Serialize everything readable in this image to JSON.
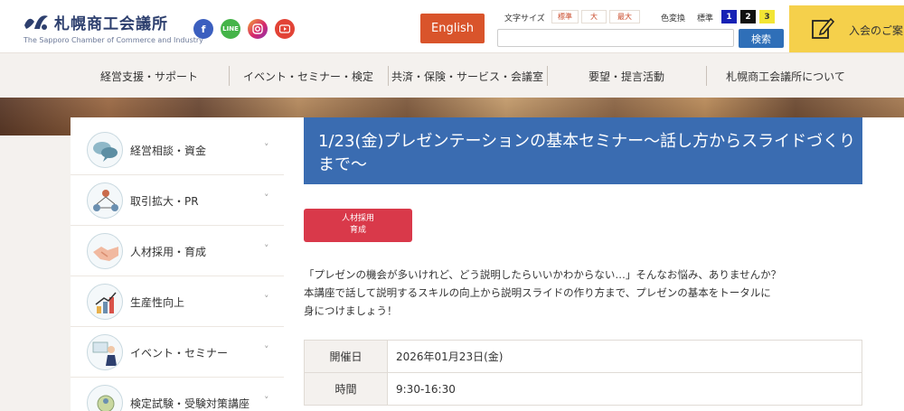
{
  "header": {
    "logo_title": "札幌商工会議所",
    "logo_subtitle": "The Sapporo Chamber of Commerce and Industry",
    "sns": {
      "line_label": "LINE"
    },
    "english_label": "English",
    "font_size": {
      "label": "文字サイズ",
      "options": [
        "標準",
        "大",
        "最大"
      ]
    },
    "color_change": {
      "label": "色変換",
      "standard": "標準",
      "options": [
        "1",
        "2",
        "3"
      ]
    },
    "search": {
      "placeholder": "",
      "button_label": "検索"
    },
    "join_label": "入会のご案"
  },
  "nav": {
    "items": [
      "経営支援・サポート",
      "イベント・セミナー・検定",
      "共済・保険・サービス・会議室",
      "要望・提言活動",
      "札幌商工会議所について"
    ]
  },
  "sidebar": {
    "items": [
      {
        "label": "経営相談・資金",
        "icon": "consultation-icon"
      },
      {
        "label": "取引拡大・PR",
        "icon": "network-icon"
      },
      {
        "label": "人材採用・育成",
        "icon": "handshake-icon"
      },
      {
        "label": "生産性向上",
        "icon": "growth-chart-icon"
      },
      {
        "label": "イベント・セミナー",
        "icon": "presenter-icon"
      },
      {
        "label": "検定試験・受験対策講座",
        "icon": "exam-icon"
      }
    ],
    "chevron": "˅"
  },
  "article": {
    "title": "1/23(金)プレゼンテーションの基本セミナー～話し方からスライドづくりまで～",
    "tag_line1": "人材採用",
    "tag_line2": "育成",
    "intro": [
      "「プレゼンの機会が多いけれど、どう説明したらいいかわからない…」そんなお悩み、ありませんか？",
      "本講座で話して説明するスキルの向上から説明スライドの作り方まで、プレゼンの基本をトータルに",
      "身につけましょう！"
    ],
    "table": [
      {
        "label": "開催日",
        "value": "2026年01月23日(金)"
      },
      {
        "label": "時間",
        "value": "9:30-16:30"
      }
    ]
  },
  "colors": {
    "brand_navy": "#2d3f6e",
    "english_button": "#d9542b",
    "search_button": "#2f6fb8",
    "join_yellow": "#f5d04b",
    "title_blue": "#3a6cb1",
    "tag_red": "#d9394a"
  }
}
